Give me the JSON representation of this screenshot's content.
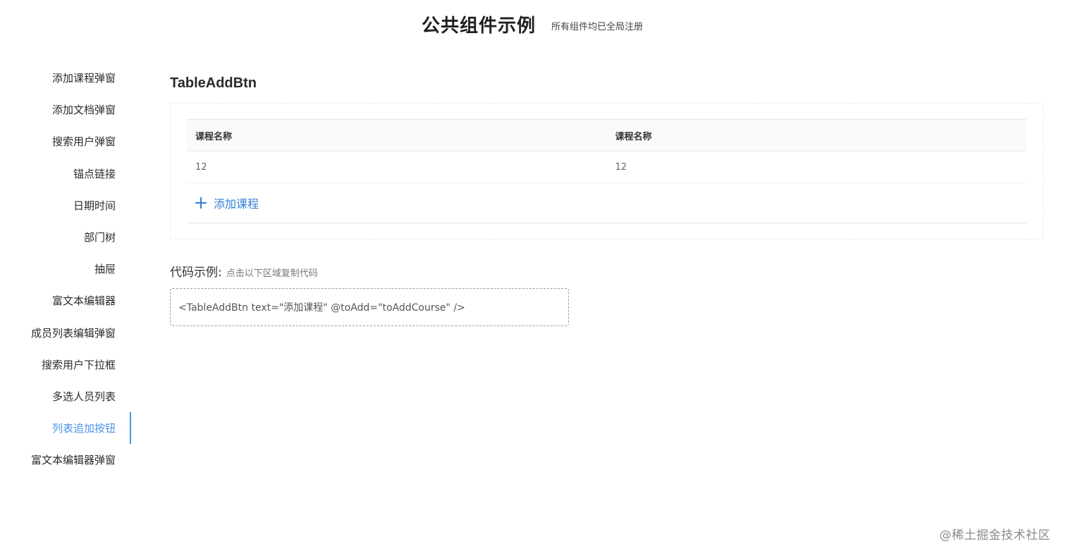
{
  "header": {
    "title": "公共组件示例",
    "subtitle": "所有组件均已全局注册"
  },
  "sidebar": {
    "items": [
      {
        "label": "添加课程弹窗",
        "active": false
      },
      {
        "label": "添加文档弹窗",
        "active": false
      },
      {
        "label": "搜索用户弹窗",
        "active": false
      },
      {
        "label": "锚点链接",
        "active": false
      },
      {
        "label": "日期时间",
        "active": false
      },
      {
        "label": "部门树",
        "active": false
      },
      {
        "label": "抽屉",
        "active": false
      },
      {
        "label": "富文本编辑器",
        "active": false
      },
      {
        "label": "成员列表编辑弹窗",
        "active": false
      },
      {
        "label": "搜索用户下拉框",
        "active": false
      },
      {
        "label": "多选人员列表",
        "active": false
      },
      {
        "label": "列表追加按钮",
        "active": true
      },
      {
        "label": "富文本编辑器弹窗",
        "active": false
      }
    ]
  },
  "main": {
    "section_title": "TableAddBtn",
    "table": {
      "columns": [
        "课程名称",
        "课程名称"
      ],
      "rows": [
        [
          "12",
          "12"
        ]
      ]
    },
    "add_button": {
      "icon": "plus-icon",
      "label": "添加课程"
    },
    "code": {
      "label": "代码示例:",
      "hint": "点击以下区域复制代码",
      "snippet": "<TableAddBtn text=\"添加课程\" @toAdd=\"toAddCourse\" />"
    }
  },
  "watermark": "@稀土掘金技术社区",
  "colors": {
    "accent": "#4a94e8",
    "link": "#2f7fd9"
  }
}
